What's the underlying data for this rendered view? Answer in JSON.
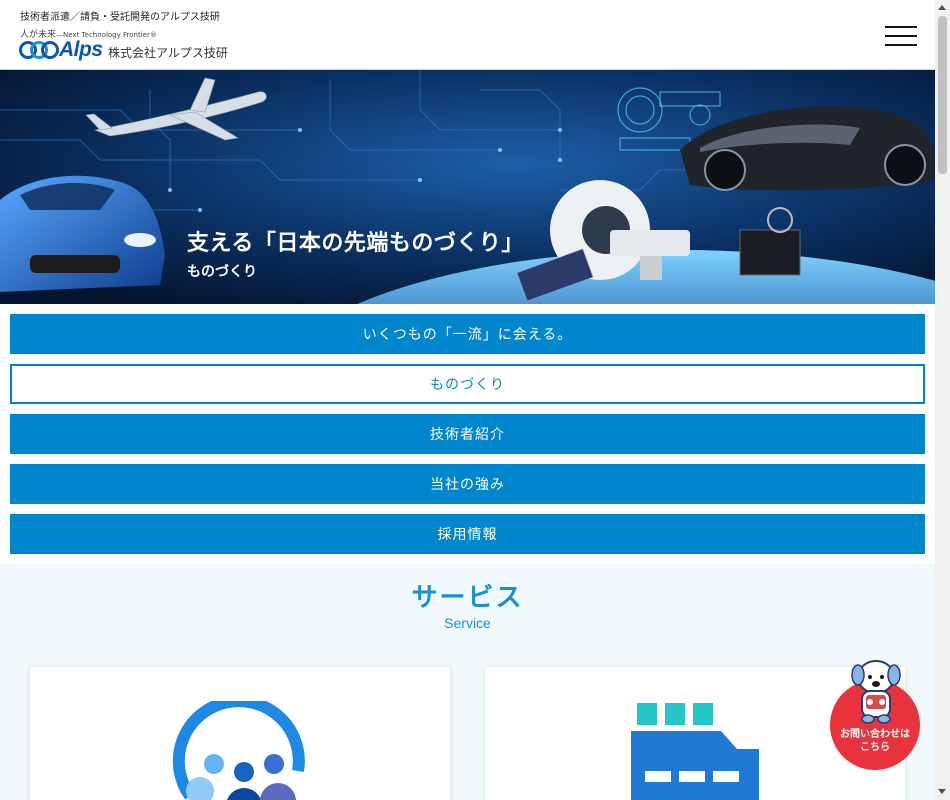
{
  "header": {
    "tagline": "技術者派遣／請負・受託開発のアルプス技研",
    "subtag": "人が未来",
    "subtag_small": "—Next Technology Frontier®",
    "brand": "Alps",
    "company": "株式会社アルプス技研",
    "menu_icon": "hamburger-icon"
  },
  "hero": {
    "title": "支える「日本の先端ものづくり」",
    "subtitle": "ものづくり"
  },
  "nav": {
    "items": [
      {
        "label": "いくつもの「一流」に会える。",
        "active": false
      },
      {
        "label": "ものづくり",
        "active": true
      },
      {
        "label": "技術者紹介",
        "active": false
      },
      {
        "label": "当社の強み",
        "active": false
      },
      {
        "label": "採用情報",
        "active": false
      }
    ]
  },
  "service": {
    "title": "サービス",
    "subtitle": "Service",
    "cards": [
      {
        "icon": "people-group-icon"
      },
      {
        "icon": "factory-icon"
      }
    ]
  },
  "contact": {
    "line1": "お問い合わせは",
    "line2": "こちら"
  },
  "colors": {
    "primary": "#0086cc",
    "heading": "#1a8fd6",
    "contact": "#e8323c",
    "brand": "#0a57b0"
  }
}
